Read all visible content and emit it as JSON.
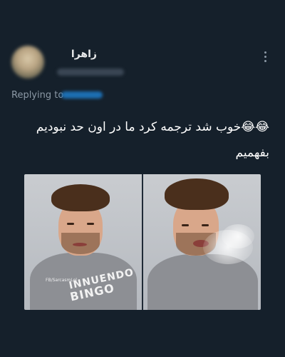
{
  "tweet": {
    "display_name": "زاهرا",
    "replying_label": "Replying to",
    "text": "😂😂خوب شد ترجمه کرد ما در اون حد نبودیم بفهمیم"
  },
  "media": {
    "watermark": "FB/SarcasmLol",
    "shirt_line_1": "INNUENDO",
    "shirt_line_2": "BINGO"
  },
  "icons": {
    "more": "more-vertical-icon"
  }
}
